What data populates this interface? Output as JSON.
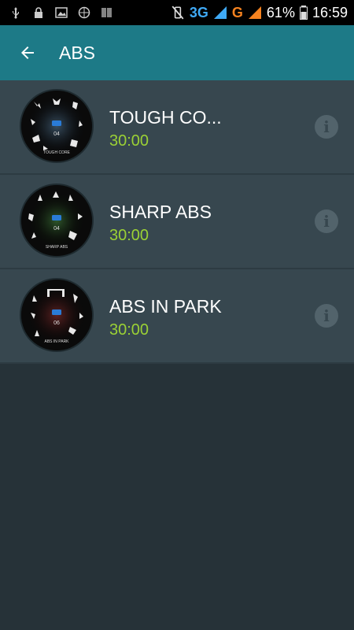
{
  "status_bar": {
    "network_3g": "3G",
    "network_g": "G",
    "battery": "61%",
    "time": "16:59"
  },
  "app_bar": {
    "title": "ABS",
    "back_icon": "arrow-back-icon"
  },
  "workouts": [
    {
      "title": "TOUGH CO...",
      "duration": "30:00",
      "thumb_center": "04",
      "thumb_caption": "TOUGH CORE",
      "accent": "#5d86a8"
    },
    {
      "title": "SHARP ABS",
      "duration": "30:00",
      "thumb_center": "04",
      "thumb_caption": "SHARP ABS",
      "accent": "#3f7a3a"
    },
    {
      "title": "ABS IN PARK",
      "duration": "30:00",
      "thumb_center": "06",
      "thumb_caption": "ABS IN PARK",
      "accent": "#7a2a2a"
    }
  ],
  "colors": {
    "app_bar": "#1d7a87",
    "list_bg": "#37474f",
    "screen_bg": "#263238",
    "duration": "#9bd135"
  }
}
